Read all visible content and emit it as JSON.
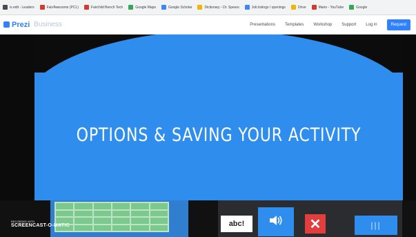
{
  "bookmarks": [
    {
      "label": "ix.edit - Leaders",
      "icon": "page-icon",
      "color": "#4a4a4a"
    },
    {
      "label": "Fair/Awesome (PCL)",
      "icon": "bookmark-icon",
      "color": "#d23b2f"
    },
    {
      "label": "Fairchild Bench Tech",
      "icon": "bookmark-icon",
      "color": "#d23b2f"
    },
    {
      "label": "Google Maps",
      "icon": "maps-icon",
      "color": "#34a853"
    },
    {
      "label": "Google Scholar",
      "icon": "scholar-icon",
      "color": "#4285f4"
    },
    {
      "label": "Dictionary - Dr. Spears",
      "icon": "book-icon",
      "color": "#f2b400"
    },
    {
      "label": "Job listings / openings",
      "icon": "globe-icon",
      "color": "#4285f4"
    },
    {
      "label": "Drive",
      "icon": "folder-icon",
      "color": "#f2b400"
    },
    {
      "label": "Mario - YouTube",
      "icon": "video-icon",
      "color": "#d23b2f"
    },
    {
      "label": "Google",
      "icon": "doc-icon",
      "color": "#34a853"
    }
  ],
  "header": {
    "logo_text": "Prezi",
    "logo_sub": "Business",
    "nav": [
      "Presentations",
      "Templates",
      "Workshop",
      "Support",
      "Log in"
    ],
    "cta_label": "Request"
  },
  "slide": {
    "title": "OPTIONS & SAVING YOUR ACTIVITY"
  },
  "toolbar": {
    "keyboard_label": "abc!",
    "sound_icon": "speaker-icon",
    "close_icon": "close-icon",
    "bars_icon": "bars-icon"
  },
  "watermark": {
    "small_text": "RECORDED WITH",
    "brand_text": "SCREENCAST-O-MATIC"
  },
  "colors": {
    "slide_blue": "#2e8ded",
    "prezi_blue": "#3181ff",
    "close_red": "#e33e3e"
  }
}
